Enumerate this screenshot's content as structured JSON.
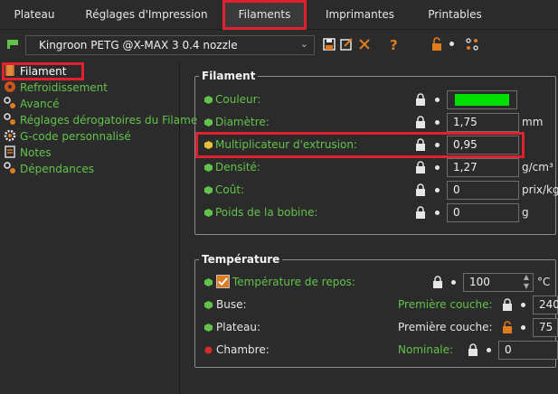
{
  "tabs": [
    "Plateau",
    "Réglages d'Impression",
    "Filaments",
    "Imprimantes",
    "Printables"
  ],
  "preset": {
    "name": "Kingroon PETG @X-MAX 3 0.4 nozzle"
  },
  "toolbar_icons": [
    "save-icon",
    "edit-icon",
    "delete-icon",
    "help-icon",
    "unlock-icon",
    "compare-icon"
  ],
  "tree": [
    "Filament",
    "Refroidissement",
    "Avancé",
    "Réglages dérogatoires du Filame",
    "G-code personnalisé",
    "Notes",
    "Dépendances"
  ],
  "filament_group": {
    "title": "Filament",
    "rows": [
      {
        "label": "Couleur:",
        "value": "",
        "unit": ""
      },
      {
        "label": "Diamètre:",
        "value": "1,75",
        "unit": "mm"
      },
      {
        "label": "Multiplicateur d'extrusion:",
        "value": "0,95",
        "unit": ""
      },
      {
        "label": "Densité:",
        "value": "1,27",
        "unit": "g/cm³"
      },
      {
        "label": "Coût:",
        "value": "0",
        "unit": "prix/kg"
      },
      {
        "label": "Poids de la bobine:",
        "value": "0",
        "unit": "g"
      }
    ],
    "swatch_color": "#00e000"
  },
  "temperature_group": {
    "title": "Température",
    "repos": {
      "label": "Température de repos:",
      "value": "100",
      "unit": "°C"
    },
    "buse": {
      "label": "Buse:",
      "sub_label": "Première couche:",
      "value": "240"
    },
    "plateau": {
      "label": "Plateau:",
      "sub_label": "Première couche:",
      "value": "75"
    },
    "chambre": {
      "label": "Chambre:",
      "sub_label": "Nominale:",
      "value": "0"
    }
  }
}
